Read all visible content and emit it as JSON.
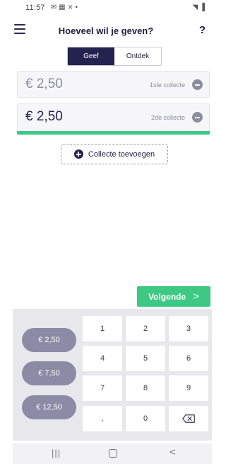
{
  "statusbar": {
    "time": "11:57",
    "left_icons": "✉ ▦ ⨯ •",
    "right_icons": "◥ ▐"
  },
  "header": {
    "title": "Hoeveel wil je geven?",
    "help": "?"
  },
  "tabs": [
    {
      "label": "Geef",
      "active": true
    },
    {
      "label": "Ontdek",
      "active": false
    }
  ],
  "collections": [
    {
      "amount": "€ 2,50",
      "label": "1ste collecte",
      "selected": false
    },
    {
      "amount": "€ 2,50",
      "label": "2de collecte",
      "selected": true
    }
  ],
  "add_collection_label": "Collecte toevoegen",
  "next_button": {
    "label": "Volgende",
    "chevron": ">"
  },
  "presets": [
    "€ 2,50",
    "€ 7,50",
    "€ 12,50"
  ],
  "keypad": {
    "keys": [
      "1",
      "2",
      "3",
      "4",
      "5",
      "6",
      "7",
      "8",
      "9",
      ",",
      "0"
    ],
    "backspace_icon": "backspace-icon"
  },
  "navbar": {
    "recent": "|||",
    "back": "<"
  },
  "colors": {
    "primary": "#24224f",
    "accent_green": "#3dc884",
    "preset_bg": "#8c8aa4",
    "keypad_bg": "#e8e8ec"
  }
}
